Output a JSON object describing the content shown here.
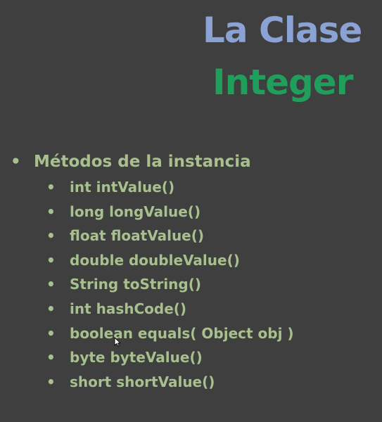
{
  "title": {
    "line1": "La Clase",
    "line2": "Integer"
  },
  "bullets": {
    "heading": "Métodos de la instancia",
    "items": [
      "int intValue()",
      "long longValue()",
      "float floatValue()",
      "double doubleValue()",
      "String toString()",
      "int hashCode()",
      "boolean equals( Object obj )",
      "byte byteValue()",
      "short shortValue()"
    ],
    "bullet_glyph": "•"
  },
  "colors": {
    "background": "#3f3f3f",
    "title_line1": "#8aa2d4",
    "title_line2": "#1f9e5c",
    "bullet_text": "#a7c08e"
  },
  "icons": {
    "cursor": "mouse-pointer-icon"
  }
}
